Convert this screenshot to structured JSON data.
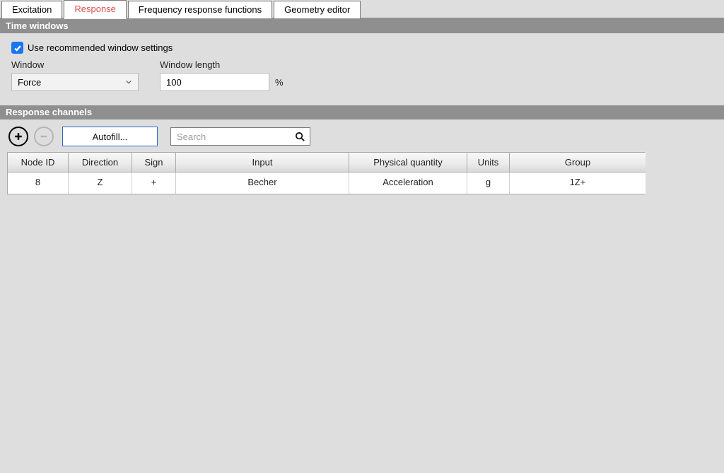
{
  "tabs": {
    "excitation": "Excitation",
    "response": "Response",
    "frf": "Frequency response functions",
    "geometry": "Geometry editor"
  },
  "time_windows": {
    "header": "Time windows",
    "use_recommended_label": "Use recommended window settings",
    "use_recommended_checked": true,
    "window_label": "Window",
    "window_value": "Force",
    "window_length_label": "Window length",
    "window_length_value": "100",
    "window_length_unit": "%"
  },
  "response_channels": {
    "header": "Response channels",
    "autofill_label": "Autofill...",
    "search_placeholder": "Search",
    "columns": {
      "node_id": "Node ID",
      "direction": "Direction",
      "sign": "Sign",
      "input": "Input",
      "phys_qty": "Physical quantity",
      "units": "Units",
      "group": "Group"
    },
    "rows": [
      {
        "node_id": "8",
        "direction": "Z",
        "sign": "+",
        "input": "Becher",
        "phys_qty": "Acceleration",
        "units": "g",
        "group": "1Z+"
      }
    ]
  }
}
